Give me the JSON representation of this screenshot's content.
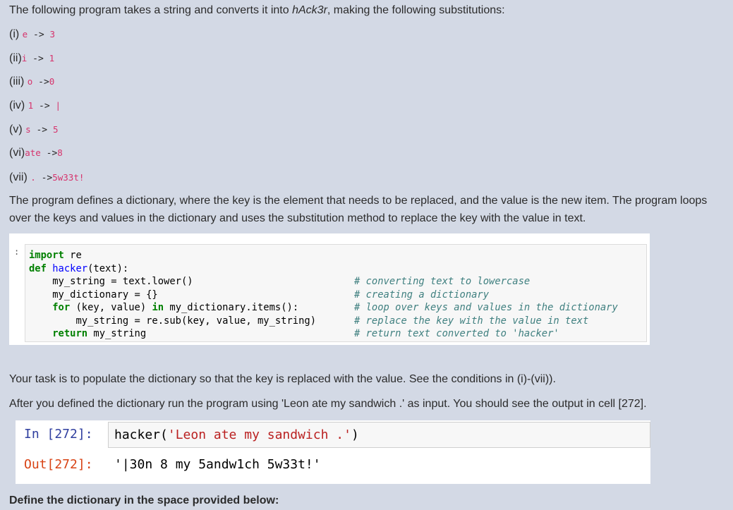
{
  "intro": {
    "prefix": "The following program takes  a string and converts it into ",
    "emph": "hAck3r",
    "suffix": ", making the following substitutions:"
  },
  "substitutions": [
    {
      "label": "(i) ",
      "from": "e",
      "arrow": " -> ",
      "to": "3"
    },
    {
      "label": "(ii)",
      "from": "i",
      "arrow": " -> ",
      "to": "1"
    },
    {
      "label": "(iii) ",
      "from": "o",
      "arrow": " ->",
      "to": "0"
    },
    {
      "label": "(iv) ",
      "from": "1",
      "arrow": " -> ",
      "to": "|"
    },
    {
      "label": "(v) ",
      "from": "s",
      "arrow": " -> ",
      "to": "5"
    },
    {
      "label": "(vi)",
      "from": "ate",
      "arrow": " ->",
      "to": "8"
    },
    {
      "label": "(vii) ",
      "from": ".",
      "arrow": " ->",
      "to": "5w33t!"
    }
  ],
  "description": "The program defines a dictionary, where  the key is the element that needs to be replaced, and the value is the new item. The program loops over the keys and values in the dictionary and uses the substitution method to replace the key with the value in text.",
  "code_cell": {
    "prompt": ":",
    "lines": {
      "l1_kw": "import",
      "l1_rest": " re",
      "l2_kw": "def",
      "l2_fn": "hacker",
      "l2_rest": "(text):",
      "l3": "    my_string = text.lower()",
      "l4": "    my_dictionary = {}",
      "l5_kw1": "for",
      "l5_mid": " (key, value) ",
      "l5_kw2": "in",
      "l5_rest": " my_dictionary.items():",
      "l6": "        my_string = re.sub(key, value, my_string)",
      "l7_kw": "return",
      "l7_rest": " my_string"
    },
    "comments": [
      "# converting text to lowercase",
      "# creating a dictionary",
      "# loop over keys and values in the dictionary",
      "# replace the key with the value in text",
      "# return text converted to 'hacker'"
    ]
  },
  "task_text": "Your task is to populate the dictionary so that the key is replaced with the value. See the conditions in (i)-(vii)).",
  "after_text": "After you defined the dictionary run the program using 'Leon ate my sandwich .' as input. You should see the output in cell [272].",
  "io_cell": {
    "in_prompt": "In [272]:",
    "call_fn": "hacker(",
    "call_arg": "'Leon ate my sandwich .'",
    "call_close": ")",
    "out_prompt": "Out[272]:",
    "output": "'|30n 8 my 5andw1ch 5w33t!'"
  },
  "define_text": "Define the dictionary in the space provided below:"
}
